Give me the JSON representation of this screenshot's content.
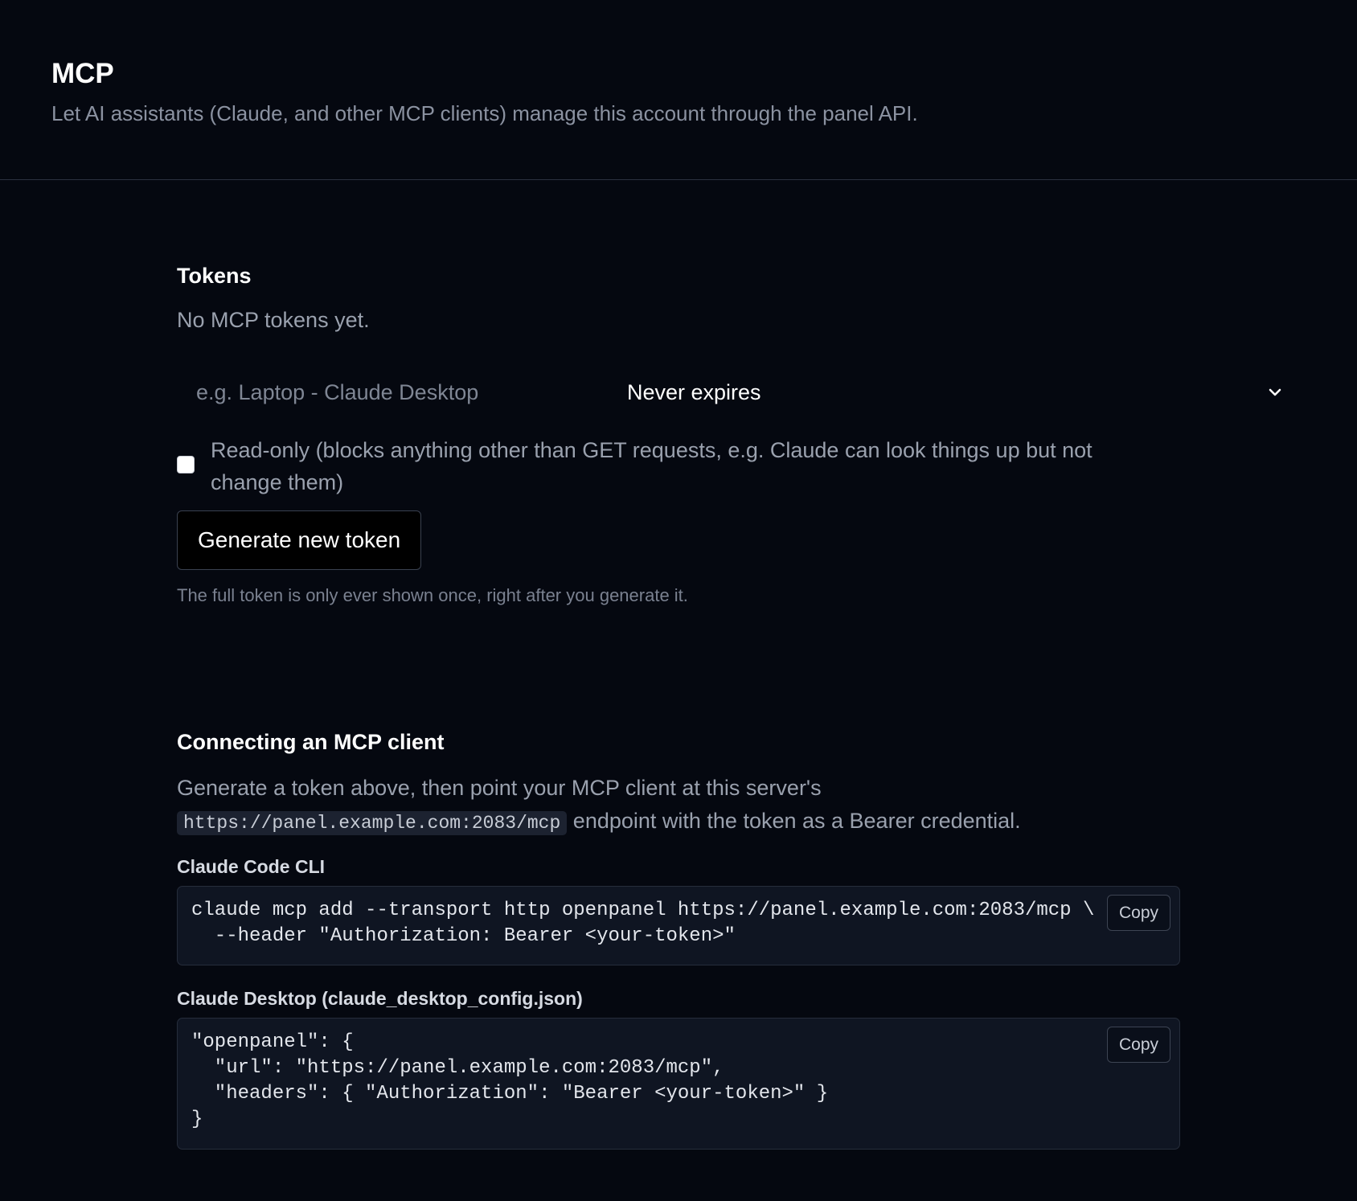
{
  "header": {
    "title": "MCP",
    "subtitle": "Let AI assistants (Claude, and other MCP clients) manage this account through the panel API."
  },
  "tokens": {
    "title": "Tokens",
    "empty_text": "No MCP tokens yet.",
    "name_placeholder": "e.g. Laptop - Claude Desktop",
    "name_value": "",
    "expiry_selected": "Never expires",
    "readonly_checked": false,
    "readonly_label": "Read-only (blocks anything other than GET requests, e.g. Claude can look things up but not change them)",
    "generate_label": "Generate new token",
    "hint": "The full token is only ever shown once, right after you generate it."
  },
  "connect": {
    "title": "Connecting an MCP client",
    "text_before": "Generate a token above, then point your MCP client at this server's",
    "endpoint": "https://panel.example.com:2083/mcp",
    "text_after": "endpoint with the token as a Bearer credential.",
    "cli": {
      "heading": "Claude Code CLI",
      "code": "claude mcp add --transport http openpanel https://panel.example.com:2083/mcp \\\n  --header \"Authorization: Bearer <your-token>\"",
      "copy_label": "Copy"
    },
    "desktop": {
      "heading": "Claude Desktop (claude_desktop_config.json)",
      "code": "\"openpanel\": {\n  \"url\": \"https://panel.example.com:2083/mcp\",\n  \"headers\": { \"Authorization\": \"Bearer <your-token>\" }\n}",
      "copy_label": "Copy"
    }
  },
  "colors": {
    "background": "#050810",
    "code_background": "#0f1522",
    "muted_text": "#9aa1ae"
  },
  "icons": {
    "expiry_select": "chevron-down-icon"
  }
}
